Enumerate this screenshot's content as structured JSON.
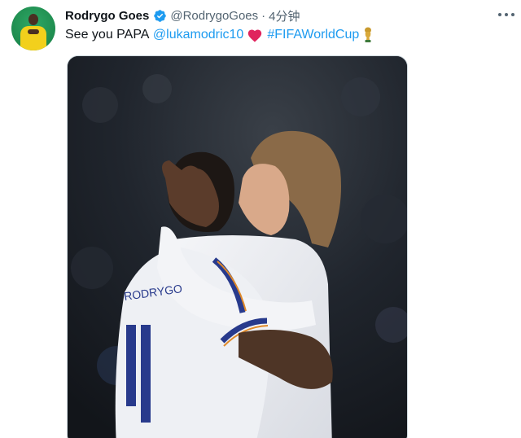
{
  "tweet": {
    "display_name": "Rodrygo Goes",
    "handle": "@RodrygoGoes",
    "separator": "·",
    "time": "4分钟",
    "text_prefix": "See you PAPA",
    "mention": "@lukamodric10",
    "hashtag": "#FIFAWorldCup"
  },
  "colors": {
    "link": "#1d9bf0",
    "verified_badge": "#1d9bf0",
    "muted_text": "#536471",
    "heart": "#f91880"
  },
  "icons": {
    "verified": "verified-badge-icon",
    "more": "more-options-icon",
    "heart": "red-heart-emoji-icon",
    "trophy": "world-cup-trophy-icon"
  }
}
